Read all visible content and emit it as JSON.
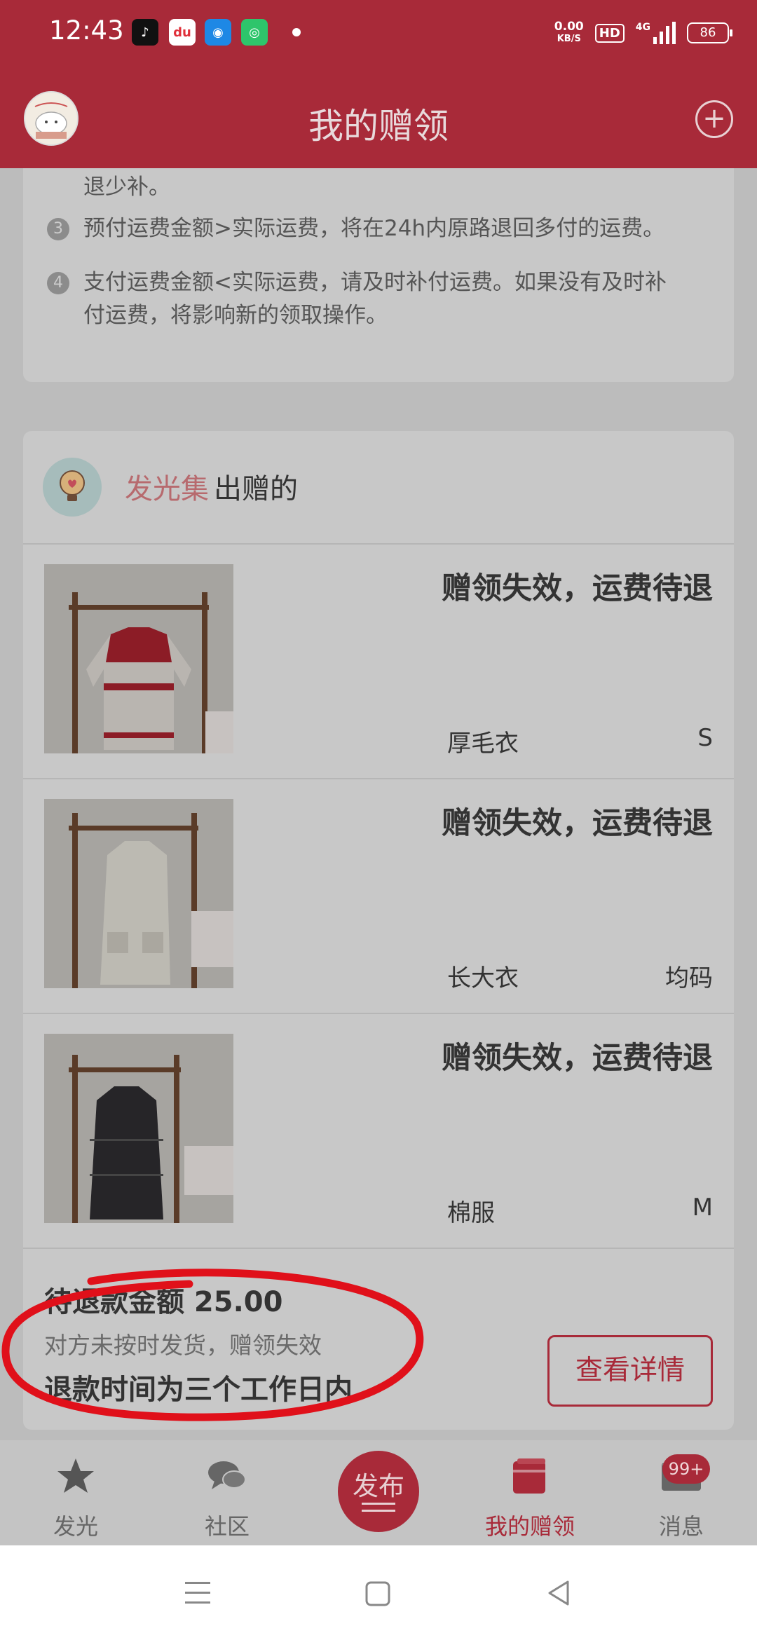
{
  "status_bar": {
    "time": "12:43",
    "net_speed": "0.00",
    "net_unit": "KB/S",
    "hd": "HD",
    "network": "4G",
    "battery": "86",
    "apps": [
      {
        "icon": "tiktok-icon",
        "color": "#111111",
        "glyph": "♪"
      },
      {
        "icon": "dewu-icon",
        "color": "#ffffff",
        "glyph": "du"
      },
      {
        "icon": "browser-icon",
        "color": "#1e88e5",
        "glyph": "◉"
      },
      {
        "icon": "app-icon",
        "color": "#2ec56b",
        "glyph": "◎"
      }
    ]
  },
  "header": {
    "title": "我的赠领",
    "avatar_icon": "avatar",
    "add_icon": "plus-circle-icon"
  },
  "notice": {
    "lines": [
      {
        "num": "",
        "text": "退少补。"
      },
      {
        "num": "3",
        "text": "预付运费金额>实际运费，将在24h内原路退回多付的运费。"
      },
      {
        "num": "4",
        "text": "支付运费金额<实际运费，请及时补付运费。如果没有及时补"
      },
      {
        "num": "",
        "text": "付运费，将影响新的领取操作。"
      }
    ]
  },
  "order": {
    "shop_name": "发光集",
    "shop_suffix": "出赠的",
    "items": [
      {
        "status": "赠领失效，运费待退",
        "name": "厚毛衣",
        "size": "S",
        "image": "red-sweater-image"
      },
      {
        "status": "赠领失效，运费待退",
        "name": "长大衣",
        "size": "均码",
        "image": "white-coat-image"
      },
      {
        "status": "赠领失效，运费待退",
        "name": "棉服",
        "size": "M",
        "image": "black-padded-coat-image"
      }
    ],
    "refund_amount": "待退款金额 25.00",
    "refund_reason": "对方未按时发货，赠领失效",
    "refund_time": "退款时间为三个工作日内",
    "detail_button": "查看详情"
  },
  "tabs": [
    {
      "label": "发光",
      "icon": "star-icon",
      "active": false
    },
    {
      "label": "社区",
      "icon": "chat-bubbles-icon",
      "active": false
    },
    {
      "label": "我的赠领",
      "icon": "gift-box-icon",
      "active": true
    },
    {
      "label": "消息",
      "icon": "mail-icon",
      "active": false
    }
  ],
  "publish_label": "发布",
  "message_badge": "99+",
  "colors": {
    "brand": "#a82a39",
    "overlay_bg": "#bcbcbc",
    "annotation": "#e0101a"
  }
}
